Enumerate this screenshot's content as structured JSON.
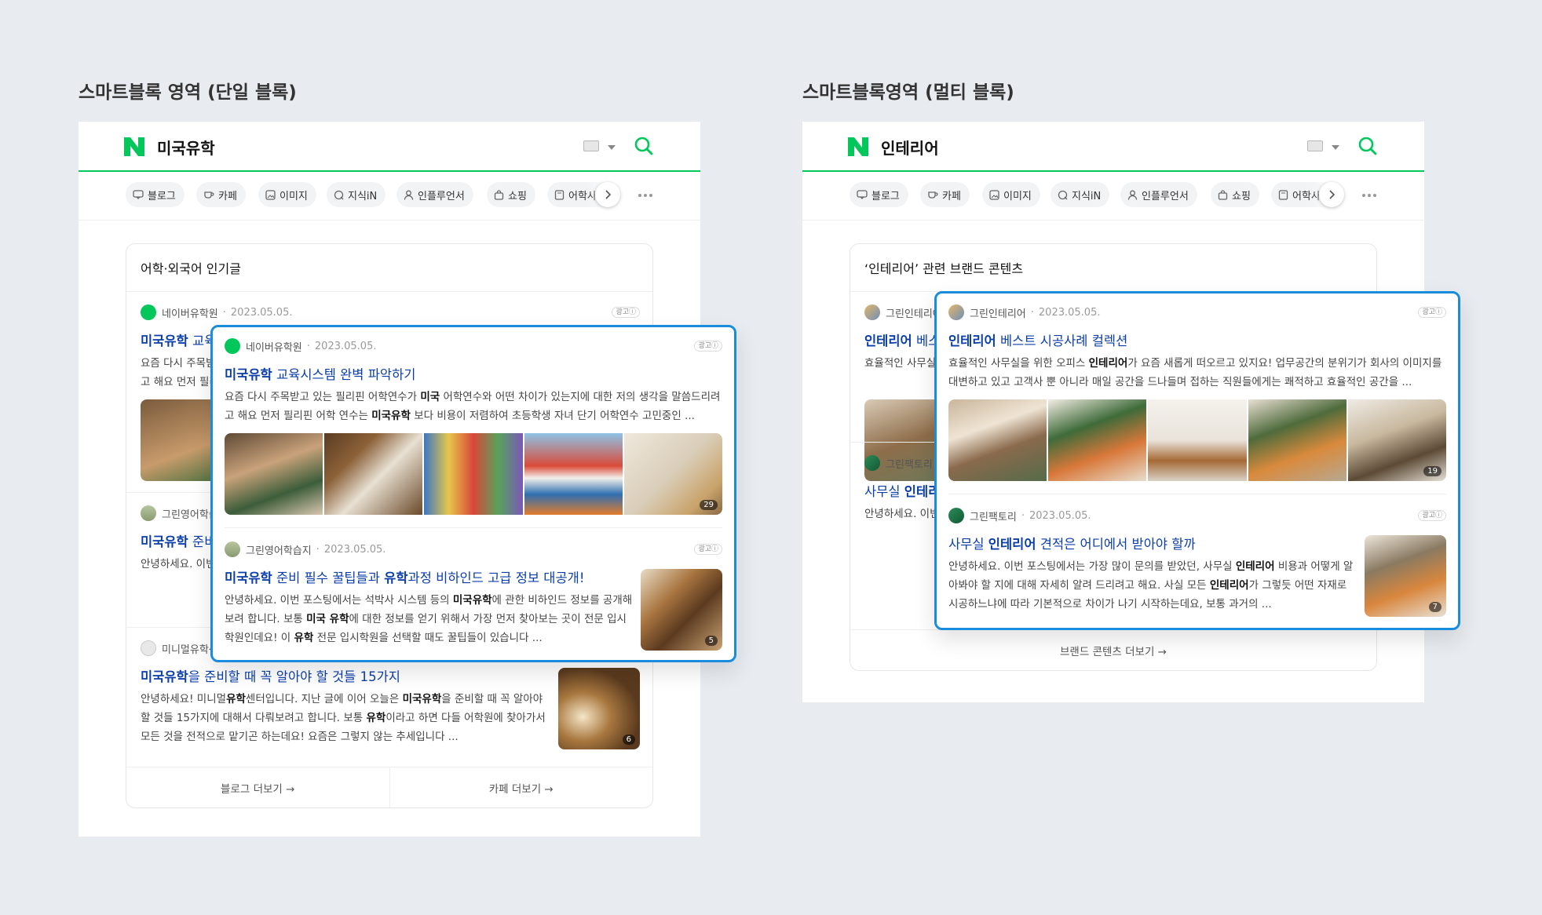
{
  "sections": {
    "left_title": "스마트블록 영역 (단일 블록)",
    "right_title": "스마트블록영역 (멀티 블록)"
  },
  "left": {
    "query": "미국유학",
    "card_title": "어학·외국어 인기글",
    "tabs": [
      "블로그",
      "카페",
      "이미지",
      "지식iN",
      "인플루언서",
      "쇼핑",
      "어학사전"
    ],
    "items": [
      {
        "source": "네이버유학원",
        "date": "2023.05.05.",
        "title_hl": "미국유학",
        "title_rest": " 교육시스템 완벽 파악하기",
        "desc_a": "요즘 다시 주목받고 있는 필리핀 어학연수가 ",
        "desc_b": "미국",
        "desc_c": " 어학연수와 어떤 차이가 있는지에 대한 저의 생각을 말씀드리려고 해요 먼저 필리핀 어학 연수는 ",
        "desc_d": "미국유학",
        "desc_e": " 보다 비용이 저렴하여  초등학생 자녀 단기 어학연수 고민중인 ...",
        "count": "29"
      },
      {
        "source": "그린영어학습지",
        "date": "2023.05.05.",
        "title_hl": "미국유학",
        "title_rest": " 준비 필수 꿀팁들과 ",
        "title_hl2": "유학",
        "title_rest2": "과정 비하인드 고급 정보 대공개!",
        "desc_a": "안녕하세요. 이번 포스팅에서는 석박사 시스템 등의 ",
        "desc_b": "미국유학",
        "desc_c": "에 관한 비하인드 정보를 공개해보려 합니다. 보통 ",
        "desc_d": "미국 유학",
        "desc_e": "에 대한 정보를 얻기 위해서 가장 먼저 찾아보는 곳이 전문 입시학원인데요! 이 ",
        "desc_f": "유학",
        "desc_g": " 전문 입시학원을 선택할 때도 꿀팁들이 있습니다 ...",
        "count": "5"
      },
      {
        "source": "미니멀유학센터",
        "date": "2023.05.05.",
        "title_hl": "미국유학",
        "title_rest": "을 준비할 때 꼭 알아야 할 것들 15가지",
        "desc_a": "안녕하세요! 미니멀",
        "desc_b": "유학",
        "desc_c": "센터입니다. 지난 글에 이어 오늘은 ",
        "desc_d": "미국유학",
        "desc_e": "을 준비할 때 꼭 알아야 할 것들 15가지에 대해서 다뤄보려고 합니다. 보통 ",
        "desc_f": "유학",
        "desc_g": "이라고 하면 다들 어학원에 찾아가서 모든 것을 전적으로 맡기곤 하는데요! 요즘은 그렇지 않는 추세입니다 ...",
        "count": "6"
      }
    ],
    "ad_label": "광고ⓘ",
    "footer": [
      "블로그 더보기 →",
      "카페 더보기 →"
    ]
  },
  "right": {
    "query": "인테리어",
    "card_title": "‘인테리어’ 관련 브랜드 콘텐츠",
    "tabs": [
      "블로그",
      "카페",
      "이미지",
      "지식iN",
      "인플루언서",
      "쇼핑",
      "어학사전"
    ],
    "items": [
      {
        "source": "그린인테리어",
        "date": "2023.05.05.",
        "title_hl": "인테리어",
        "title_rest": " 베스트 시공사례 컬렉션",
        "desc_a": "효율적인 사무실을 위한 오피스 ",
        "desc_b": "인테리어",
        "desc_c": "가 요즘 새롭게 떠오르고 있지요! 업무공간의 분위기가 회사의 이미지를 대변하고 있고 고객사 뿐 아니라 매일 공간을 드나들며 접하는 직원들에게는 쾌적하고 효율적인 공간을 ...",
        "count": "19"
      },
      {
        "source": "그린팩토리",
        "date": "2023.05.05.",
        "title_pre": "사무실 ",
        "title_hl": "인테리어",
        "title_rest": " 견적은 어디에서 받아야 할까",
        "desc_a": "안녕하세요. 이번 포스팅에서는 가장 많이 문의를 받았던, 사무실 ",
        "desc_b": "인테리어",
        "desc_c": " 비용과 어떻게 알아봐야 할 지에 대해 자세히 알려 드리려고 해요. 사실 모든 ",
        "desc_d": "인테리어",
        "desc_e": "가 그렇듯 어떤 자재로 시공하느냐에 따라 기본적으로 차이가 나기 시작하는데요, 보통 과거의 ...",
        "count": "7"
      }
    ],
    "ad_label": "광고ⓘ",
    "footer": "브랜드 콘텐츠 더보기 →"
  },
  "colors": {
    "naver_green": "#03c75a",
    "link_blue": "#0b3ea8",
    "highlight_border": "#1a8cdc",
    "background": "#e8ecf1"
  },
  "icons": [
    "naver-n-logo",
    "keyboard-icon",
    "search-icon",
    "chevron-right-icon",
    "more-icon",
    "info-icon"
  ]
}
